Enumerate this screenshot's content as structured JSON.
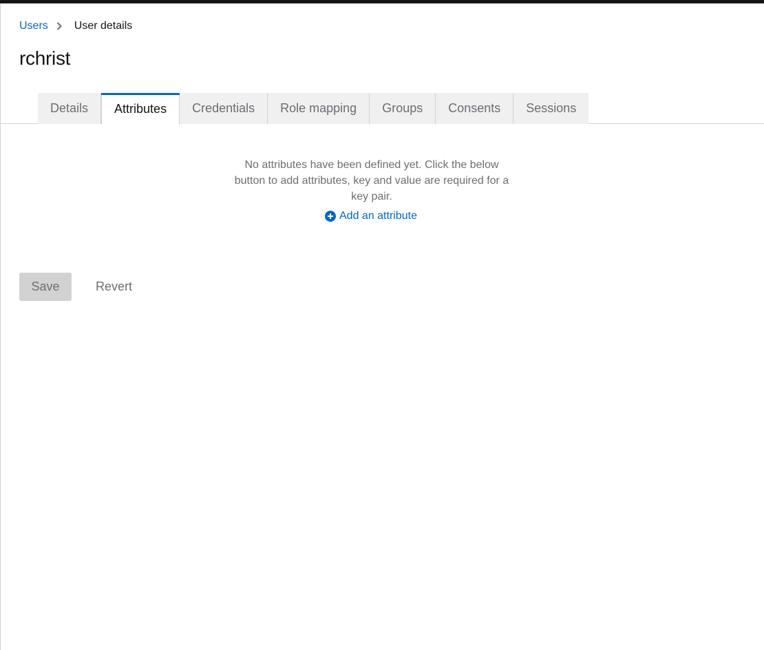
{
  "breadcrumb": {
    "parent_label": "Users",
    "current_label": "User details"
  },
  "page": {
    "title": "rchrist"
  },
  "tabs": [
    {
      "label": "Details",
      "active": false
    },
    {
      "label": "Attributes",
      "active": true
    },
    {
      "label": "Credentials",
      "active": false
    },
    {
      "label": "Role mapping",
      "active": false
    },
    {
      "label": "Groups",
      "active": false
    },
    {
      "label": "Consents",
      "active": false
    },
    {
      "label": "Sessions",
      "active": false
    }
  ],
  "attributes": {
    "empty_message": "No attributes have been defined yet. Click the below button to add attributes, key and value are required for a key pair.",
    "add_label": "Add an attribute",
    "add_icon": "plus-circle-icon"
  },
  "actions": {
    "save_label": "Save",
    "revert_label": "Revert"
  },
  "colors": {
    "link": "#0066cc",
    "active_tab_accent": "#0066cc",
    "tab_inactive_bg": "#f0f0f0",
    "disabled_button_bg": "#d2d2d2"
  }
}
